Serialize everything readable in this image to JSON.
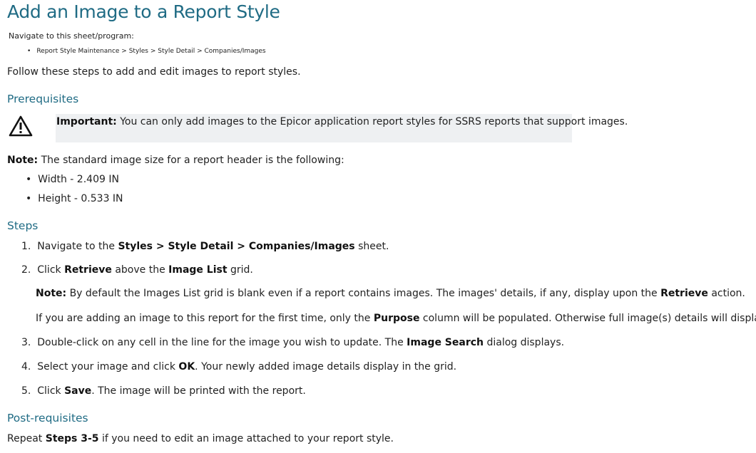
{
  "title": "Add an Image to a Report Style",
  "navigate_label": "Navigate to this sheet/program:",
  "nav_path": "Report Style Maintenance > Styles > Style Detail > Companies/Images",
  "intro": "Follow these steps to add and edit images to report styles.",
  "prerequisites": {
    "heading": "Prerequisites",
    "important_label": "Important:",
    "important_text": " You can only add images to the Epicor application report styles for SSRS reports that support images.",
    "icon": "warning-icon"
  },
  "note_size": {
    "label": "Note:",
    "text": " The standard image size for a report header is the following:",
    "items": [
      "Width - 2.409 IN",
      "Height - 0.533 IN"
    ]
  },
  "steps": {
    "heading": "Steps",
    "s1": {
      "num": "1.",
      "a": "Navigate to the ",
      "b": "Styles > Style Detail > Companies/Images",
      "c": " sheet."
    },
    "s2": {
      "num": "2.",
      "a": "Click ",
      "b": "Retrieve",
      "c": " above the ",
      "d": "Image List",
      "e": " grid."
    },
    "s2_note": {
      "label": "Note:",
      "a": " By default the Images List grid is blank even if a report contains images. The images' details, if any, display upon the ",
      "b": "Retrieve",
      "c": " action."
    },
    "s2_info": {
      "a": "If you are adding an image to this report for the first time, only the ",
      "b": "Purpose",
      "c": " column will be populated. Otherwise full image(s) details will display."
    },
    "s3": {
      "num": "3.",
      "a": "Double-click on any cell in the line for the image you wish to update. The ",
      "b": "Image Search",
      "c": " dialog displays."
    },
    "s4": {
      "num": "4.",
      "a": "Select your image and click ",
      "b": "OK",
      "c": ". Your newly added image details display in the grid."
    },
    "s5": {
      "num": "5.",
      "a": "Click ",
      "b": "Save",
      "c": ". The image will be printed with the report."
    }
  },
  "post": {
    "heading": "Post-requisites",
    "a": "Repeat ",
    "b": "Steps 3-5",
    "c": " if you need to edit an image attached to your report style."
  }
}
